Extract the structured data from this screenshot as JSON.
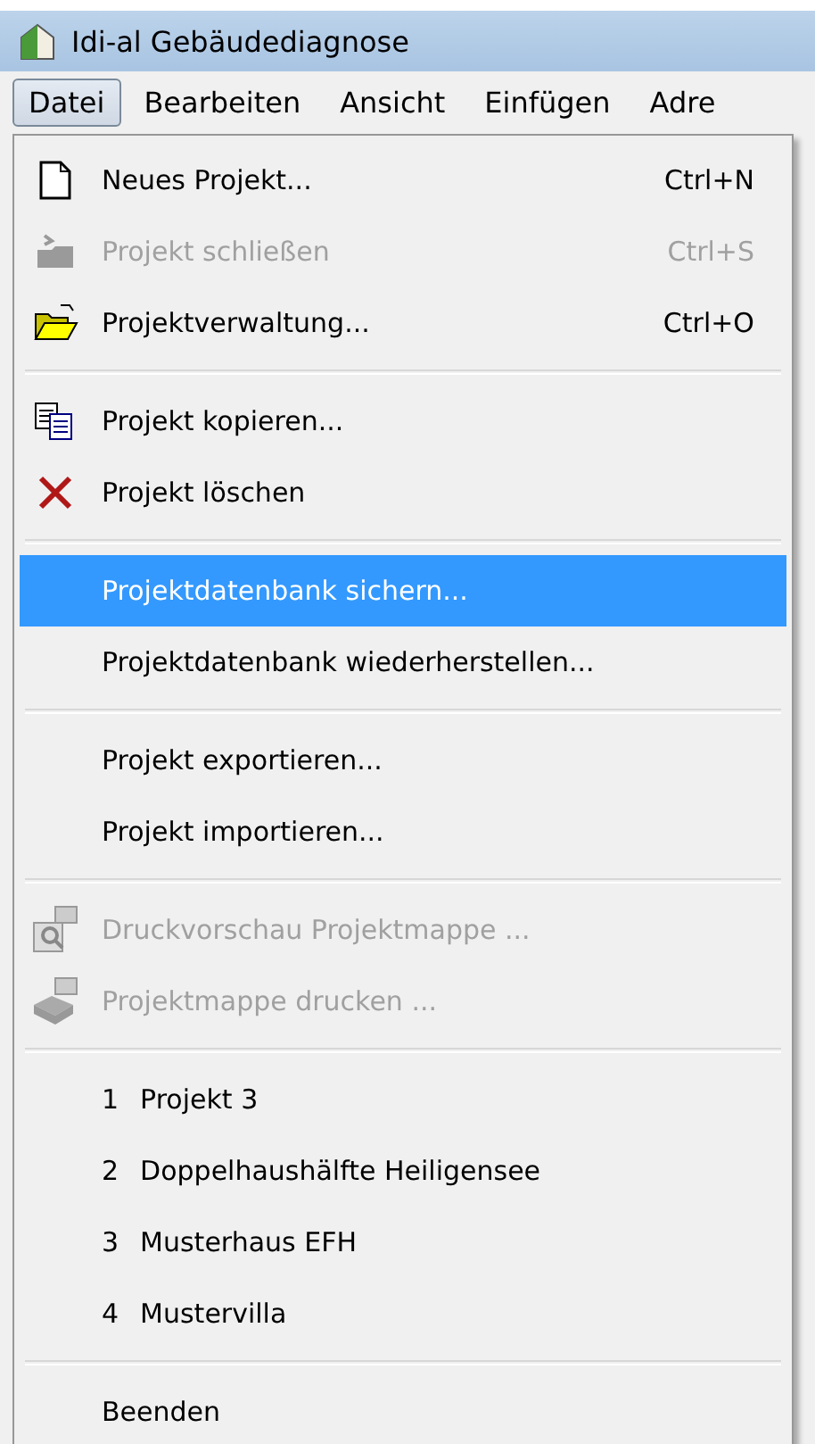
{
  "window": {
    "title": "Idi-al Gebäudediagnose"
  },
  "menu_bar": [
    {
      "label": "Datei",
      "selected": true
    },
    {
      "label": "Bearbeiten",
      "selected": false
    },
    {
      "label": "Ansicht",
      "selected": false
    },
    {
      "label": "Einfügen",
      "selected": false
    },
    {
      "label": "Adre",
      "selected": false
    }
  ],
  "menu": [
    {
      "kind": "command",
      "label": "Neues Projekt...",
      "shortcut": "Ctrl+N",
      "disabled": false,
      "selected": false
    },
    {
      "kind": "command",
      "label": "Projekt schließen",
      "shortcut": "Ctrl+S",
      "disabled": true,
      "selected": false
    },
    {
      "kind": "command",
      "label": "Projektverwaltung...",
      "shortcut": "Ctrl+O",
      "disabled": false,
      "selected": false
    },
    {
      "kind": "separator"
    },
    {
      "kind": "command",
      "label": "Projekt kopieren...",
      "disabled": false,
      "selected": false
    },
    {
      "kind": "command",
      "label": "Projekt löschen",
      "disabled": false,
      "selected": false
    },
    {
      "kind": "separator"
    },
    {
      "kind": "command",
      "label": "Projektdatenbank sichern...",
      "disabled": false,
      "selected": true
    },
    {
      "kind": "command",
      "label": "Projektdatenbank wiederherstellen...",
      "disabled": false,
      "selected": false
    },
    {
      "kind": "separator"
    },
    {
      "kind": "command",
      "label": "Projekt exportieren...",
      "disabled": false,
      "selected": false
    },
    {
      "kind": "command",
      "label": "Projekt importieren...",
      "disabled": false,
      "selected": false
    },
    {
      "kind": "separator"
    },
    {
      "kind": "command",
      "label": "Druckvorschau Projektmappe ...",
      "disabled": true,
      "selected": false
    },
    {
      "kind": "command",
      "label": "Projektmappe drucken ...",
      "disabled": true,
      "selected": false
    },
    {
      "kind": "separator"
    },
    {
      "kind": "recent",
      "number": "1",
      "label": "Projekt 3",
      "disabled": false,
      "selected": false
    },
    {
      "kind": "recent",
      "number": "2",
      "label": "Doppelhaushälfte Heiligensee",
      "disabled": false,
      "selected": false
    },
    {
      "kind": "recent",
      "number": "3",
      "label": "Musterhaus EFH",
      "disabled": false,
      "selected": false
    },
    {
      "kind": "recent",
      "number": "4",
      "label": "Mustervilla",
      "disabled": false,
      "selected": false
    },
    {
      "kind": "separator"
    },
    {
      "kind": "command",
      "label": "Beenden",
      "disabled": false,
      "selected": false
    }
  ]
}
